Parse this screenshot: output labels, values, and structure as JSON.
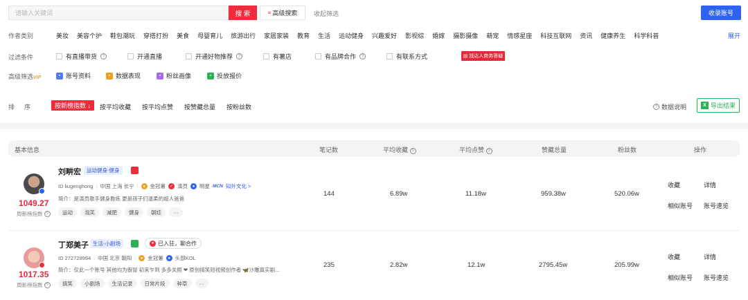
{
  "search": {
    "placeholder": "请输入关键词",
    "button": "搜 索",
    "advanced": "高级搜索",
    "advanced_icon": "≡",
    "collapse": "收起筛选",
    "collect": "收录账号"
  },
  "categories": {
    "label": "作者类别",
    "items": [
      "美妆",
      "美容个护",
      "鞋包潮玩",
      "穿搭打扮",
      "美食",
      "母婴育儿",
      "旅游出行",
      "家居家装",
      "教育",
      "生活",
      "运动健身",
      "兴趣爱好",
      "影视综",
      "婚嫁",
      "摄影摄像",
      "萌宠",
      "情感星座",
      "科技互联网",
      "资讯",
      "健康养生",
      "科学科普"
    ],
    "expand": "展开"
  },
  "filters": {
    "label": "过滤条件",
    "items": [
      "有直播带货",
      "开通直播",
      "开通好物推荐",
      "有薯店",
      "有品牌合作",
      "有联系方式"
    ],
    "ad": "找达人商务答疑"
  },
  "advanced_filters": {
    "label": "高级筛选",
    "vip": "VIP",
    "items": [
      "账号资料",
      "数据表现",
      "粉丝画像",
      "投放报价"
    ]
  },
  "sort": {
    "label": "排序",
    "active": "按新榜指数",
    "items": [
      "按平均收藏",
      "按平均点赞",
      "按赞藏总量",
      "按粉丝数"
    ],
    "data_desc": "数据说明",
    "export": "导出结果",
    "export_icon": "X"
  },
  "table": {
    "headers": [
      "基本信息",
      "笔记数",
      "平均收藏",
      "平均点赞",
      "赞藏总量",
      "粉丝数",
      "操作"
    ],
    "rows": [
      {
        "name": "刘畊宏",
        "category": "运动健身-健身",
        "score": "1049.27",
        "score_label": "周新榜指数",
        "id": "ID liugenghong",
        "location": "中国 上海 长宁",
        "badge1": "金冠薯",
        "badge2": "演员",
        "badge3": "明星",
        "mcn": "MCN",
        "mcn_org": "知外文化 >",
        "intro": "简介：是演员歌手健身教练 更是孩子们温柔的超人爸爸",
        "tags": [
          "运动",
          "泡芙",
          "减肥",
          "健身",
          "朝娃",
          "···"
        ],
        "notes": "144",
        "avg_fav": "6.89w",
        "avg_like": "11.18w",
        "total": "959.38w",
        "fans": "520.06w",
        "ops": [
          "收藏",
          "详情",
          "相似账号",
          "账号速览"
        ]
      },
      {
        "name": "丁郑美子",
        "category": "生活-小剧场",
        "score": "1017.35",
        "score_label": "周新榜指数",
        "joined": "已入驻，聊合作",
        "id": "ID 272729994",
        "location": "中国 北京 朝阳",
        "badge1": "金冠薯",
        "badge3": "头部KOL",
        "intro": "简介：仅此一个账号 其他均为假冒 初来乍到 多多关照 ❤ 原创搞笑短视频创作者 🦋沙雕真实剧...",
        "tags": [
          "搞笑",
          "小剧场",
          "生活记录",
          "日常片段",
          "种草",
          "···"
        ],
        "notes": "235",
        "avg_fav": "2.82w",
        "avg_like": "12.1w",
        "total": "2795.45w",
        "fans": "205.99w",
        "ops": [
          "收藏",
          "详情",
          "相似账号",
          "账号速览"
        ]
      }
    ]
  },
  "colors": {
    "accent_red": "#ee2d3c",
    "brand_blue": "#2d63f0",
    "export_green": "#2bb255"
  }
}
